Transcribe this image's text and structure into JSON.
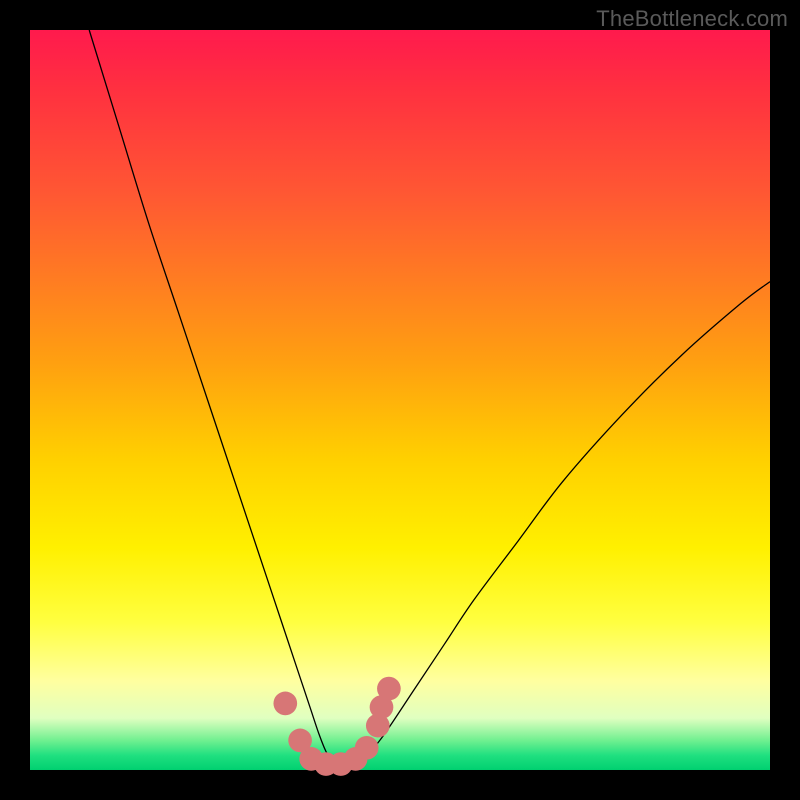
{
  "watermark": "TheBottleneck.com",
  "chart_data": {
    "type": "line",
    "title": "",
    "xlabel": "",
    "ylabel": "",
    "xlim": [
      0,
      100
    ],
    "ylim": [
      0,
      100
    ],
    "grid": false,
    "legend": false,
    "series": [
      {
        "name": "bottleneck-curve",
        "color": "#000000",
        "x": [
          8,
          12,
          16,
          20,
          24,
          28,
          30,
          32,
          34,
          36,
          37,
          38,
          39,
          40,
          41,
          42,
          43,
          44,
          46,
          48,
          52,
          56,
          60,
          66,
          72,
          80,
          88,
          96,
          100
        ],
        "y": [
          100,
          87,
          74,
          62,
          50,
          38,
          32,
          26,
          20,
          14,
          11,
          8,
          5,
          2.5,
          1,
          0.5,
          0.5,
          1,
          2.5,
          5,
          11,
          17,
          23,
          31,
          39,
          48,
          56,
          63,
          66
        ]
      },
      {
        "name": "highlight-dots",
        "color": "#d77676",
        "type": "scatter",
        "x": [
          34.5,
          36.5,
          38,
          40,
          42,
          44,
          45.5,
          47,
          47.5,
          48.5
        ],
        "y": [
          9,
          4,
          1.5,
          0.8,
          0.8,
          1.5,
          3,
          6,
          8.5,
          11
        ]
      }
    ],
    "background_gradient": {
      "top": "#ff1a4d",
      "mid": "#ffd000",
      "bottom": "#00d070"
    }
  }
}
